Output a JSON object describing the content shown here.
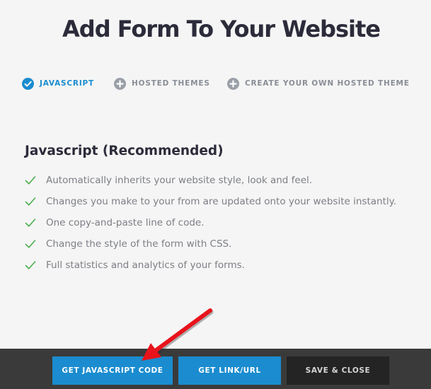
{
  "page": {
    "title": "Add Form To Your Website"
  },
  "tabs": [
    {
      "label": "JAVASCRIPT",
      "icon": "check-circle-icon",
      "active": true
    },
    {
      "label": "HOSTED THEMES",
      "icon": "plus-circle-icon",
      "active": false
    },
    {
      "label": "CREATE YOUR OWN HOSTED THEME",
      "icon": "plus-circle-icon",
      "active": false
    }
  ],
  "section": {
    "heading": "Javascript (Recommended)",
    "features": [
      "Automatically inherits your website style, look and feel.",
      "Changes you make to your from are updated onto your website instantly.",
      "One copy-and-paste line of code.",
      "Change the style of the form with CSS.",
      "Full statistics and analytics of your forms."
    ]
  },
  "footer": {
    "get_js_label": "GET JAVASCRIPT CODE",
    "get_link_label": "GET LINK/URL",
    "save_close_label": "SAVE & CLOSE"
  },
  "colors": {
    "accent": "#1a8ccf",
    "check": "#4caf50",
    "annotation_arrow": "#e8131b",
    "footer_bg": "#3a3a3a"
  }
}
